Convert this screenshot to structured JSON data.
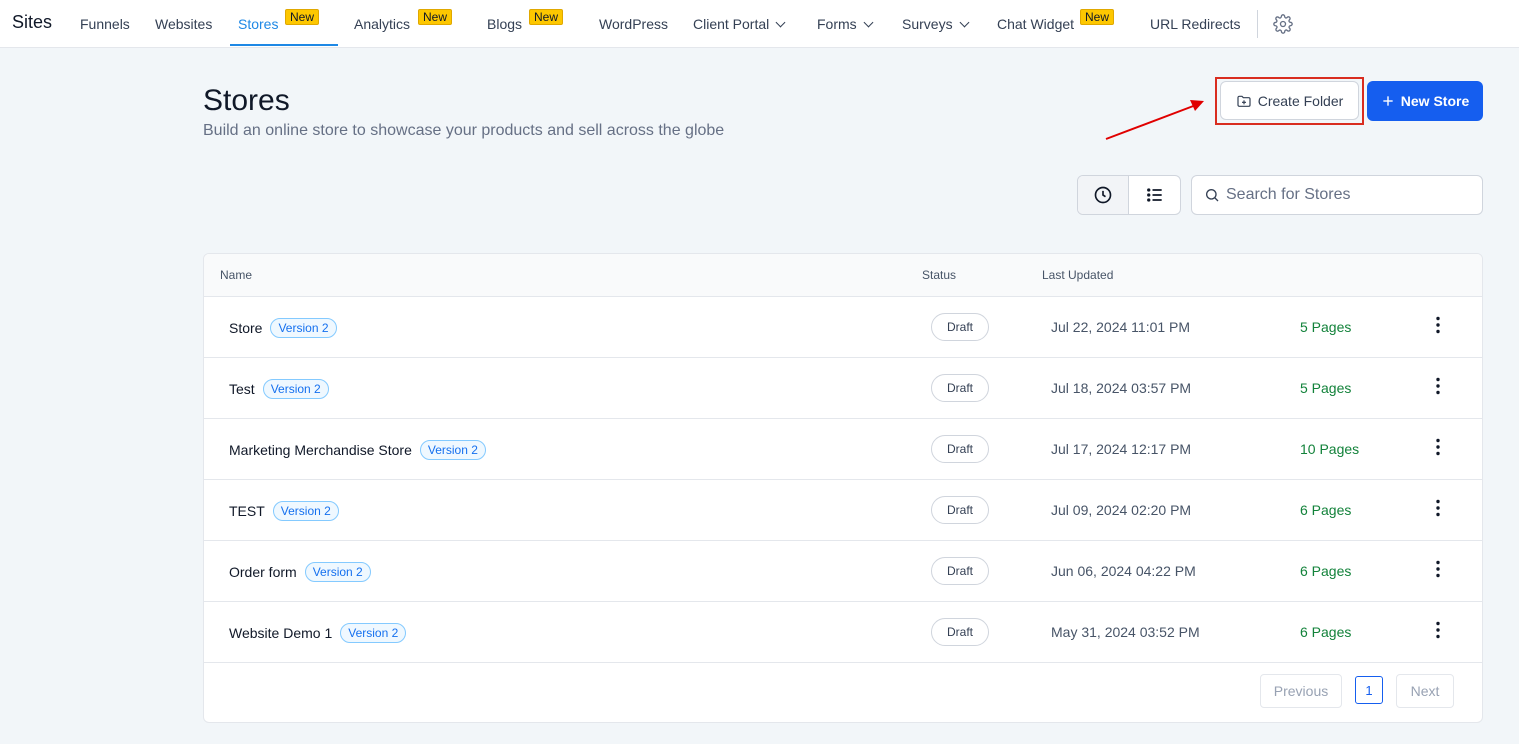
{
  "nav": {
    "brand": "Sites",
    "items": [
      {
        "label": "Funnels"
      },
      {
        "label": "Websites"
      },
      {
        "label": "Stores",
        "badge": "New"
      },
      {
        "label": "Analytics",
        "badge": "New"
      },
      {
        "label": "Blogs",
        "badge": "New"
      },
      {
        "label": "WordPress"
      },
      {
        "label": "Client Portal"
      },
      {
        "label": "Forms"
      },
      {
        "label": "Surveys"
      },
      {
        "label": "Chat Widget",
        "badge": "New"
      },
      {
        "label": "URL Redirects"
      }
    ],
    "active": "Stores"
  },
  "header": {
    "title": "Stores",
    "subtitle": "Build an online store to showcase your products and sell across the globe",
    "create_folder_label": "Create Folder",
    "new_store_label": "New Store"
  },
  "toolbar": {
    "search_placeholder": "Search for Stores"
  },
  "table": {
    "columns": [
      "Name",
      "Status",
      "Last Updated"
    ],
    "rows": [
      {
        "name": "Store",
        "version": "Version 2",
        "status": "Draft",
        "updated": "Jul 22, 2024 11:01 PM",
        "pages": "5 Pages"
      },
      {
        "name": "Test",
        "version": "Version 2",
        "status": "Draft",
        "updated": "Jul 18, 2024 03:57 PM",
        "pages": "5 Pages"
      },
      {
        "name": "Marketing Merchandise Store",
        "version": "Version 2",
        "status": "Draft",
        "updated": "Jul 17, 2024 12:17 PM",
        "pages": "10 Pages"
      },
      {
        "name": "TEST",
        "version": "Version 2",
        "status": "Draft",
        "updated": "Jul 09, 2024 02:20 PM",
        "pages": "6 Pages"
      },
      {
        "name": "Order form",
        "version": "Version 2",
        "status": "Draft",
        "updated": "Jun 06, 2024 04:22 PM",
        "pages": "6 Pages"
      },
      {
        "name": "Website Demo 1",
        "version": "Version 2",
        "status": "Draft",
        "updated": "May 31, 2024 03:52 PM",
        "pages": "6 Pages"
      }
    ]
  },
  "pagination": {
    "previous_label": "Previous",
    "current_page": "1",
    "next_label": "Next"
  },
  "colors": {
    "accent": "#155eef",
    "nav_active": "#1e88e5",
    "pages_green": "#12823a",
    "highlight_red": "#d92d20",
    "badge_yellow": "#fdc700"
  }
}
